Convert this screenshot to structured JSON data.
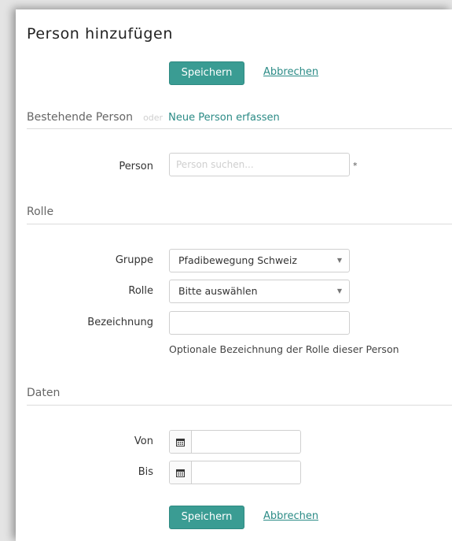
{
  "form": {
    "title": "Person hinzufügen",
    "save_label": "Speichern",
    "cancel_label": "Abbrechen"
  },
  "person_section": {
    "title": "Bestehende Person",
    "or_text": "oder",
    "new_person_link": "Neue Person erfassen",
    "person_label": "Person",
    "person_placeholder": "Person suchen...",
    "required_marker": "*"
  },
  "role_section": {
    "title": "Rolle",
    "group_label": "Gruppe",
    "group_value": "Pfadibewegung Schweiz",
    "role_label": "Rolle",
    "role_value": "Bitte auswählen",
    "designation_label": "Bezeichnung",
    "designation_value": "",
    "designation_hint": "Optionale Bezeichnung der Rolle dieser Person"
  },
  "dates_section": {
    "title": "Daten",
    "from_label": "Von",
    "from_value": "",
    "to_label": "Bis",
    "to_value": ""
  },
  "icons": {
    "dropdown": "caret-down-icon",
    "calendar": "calendar-icon"
  },
  "colors": {
    "primary": "#3a9c93",
    "link": "#2b8b86"
  }
}
